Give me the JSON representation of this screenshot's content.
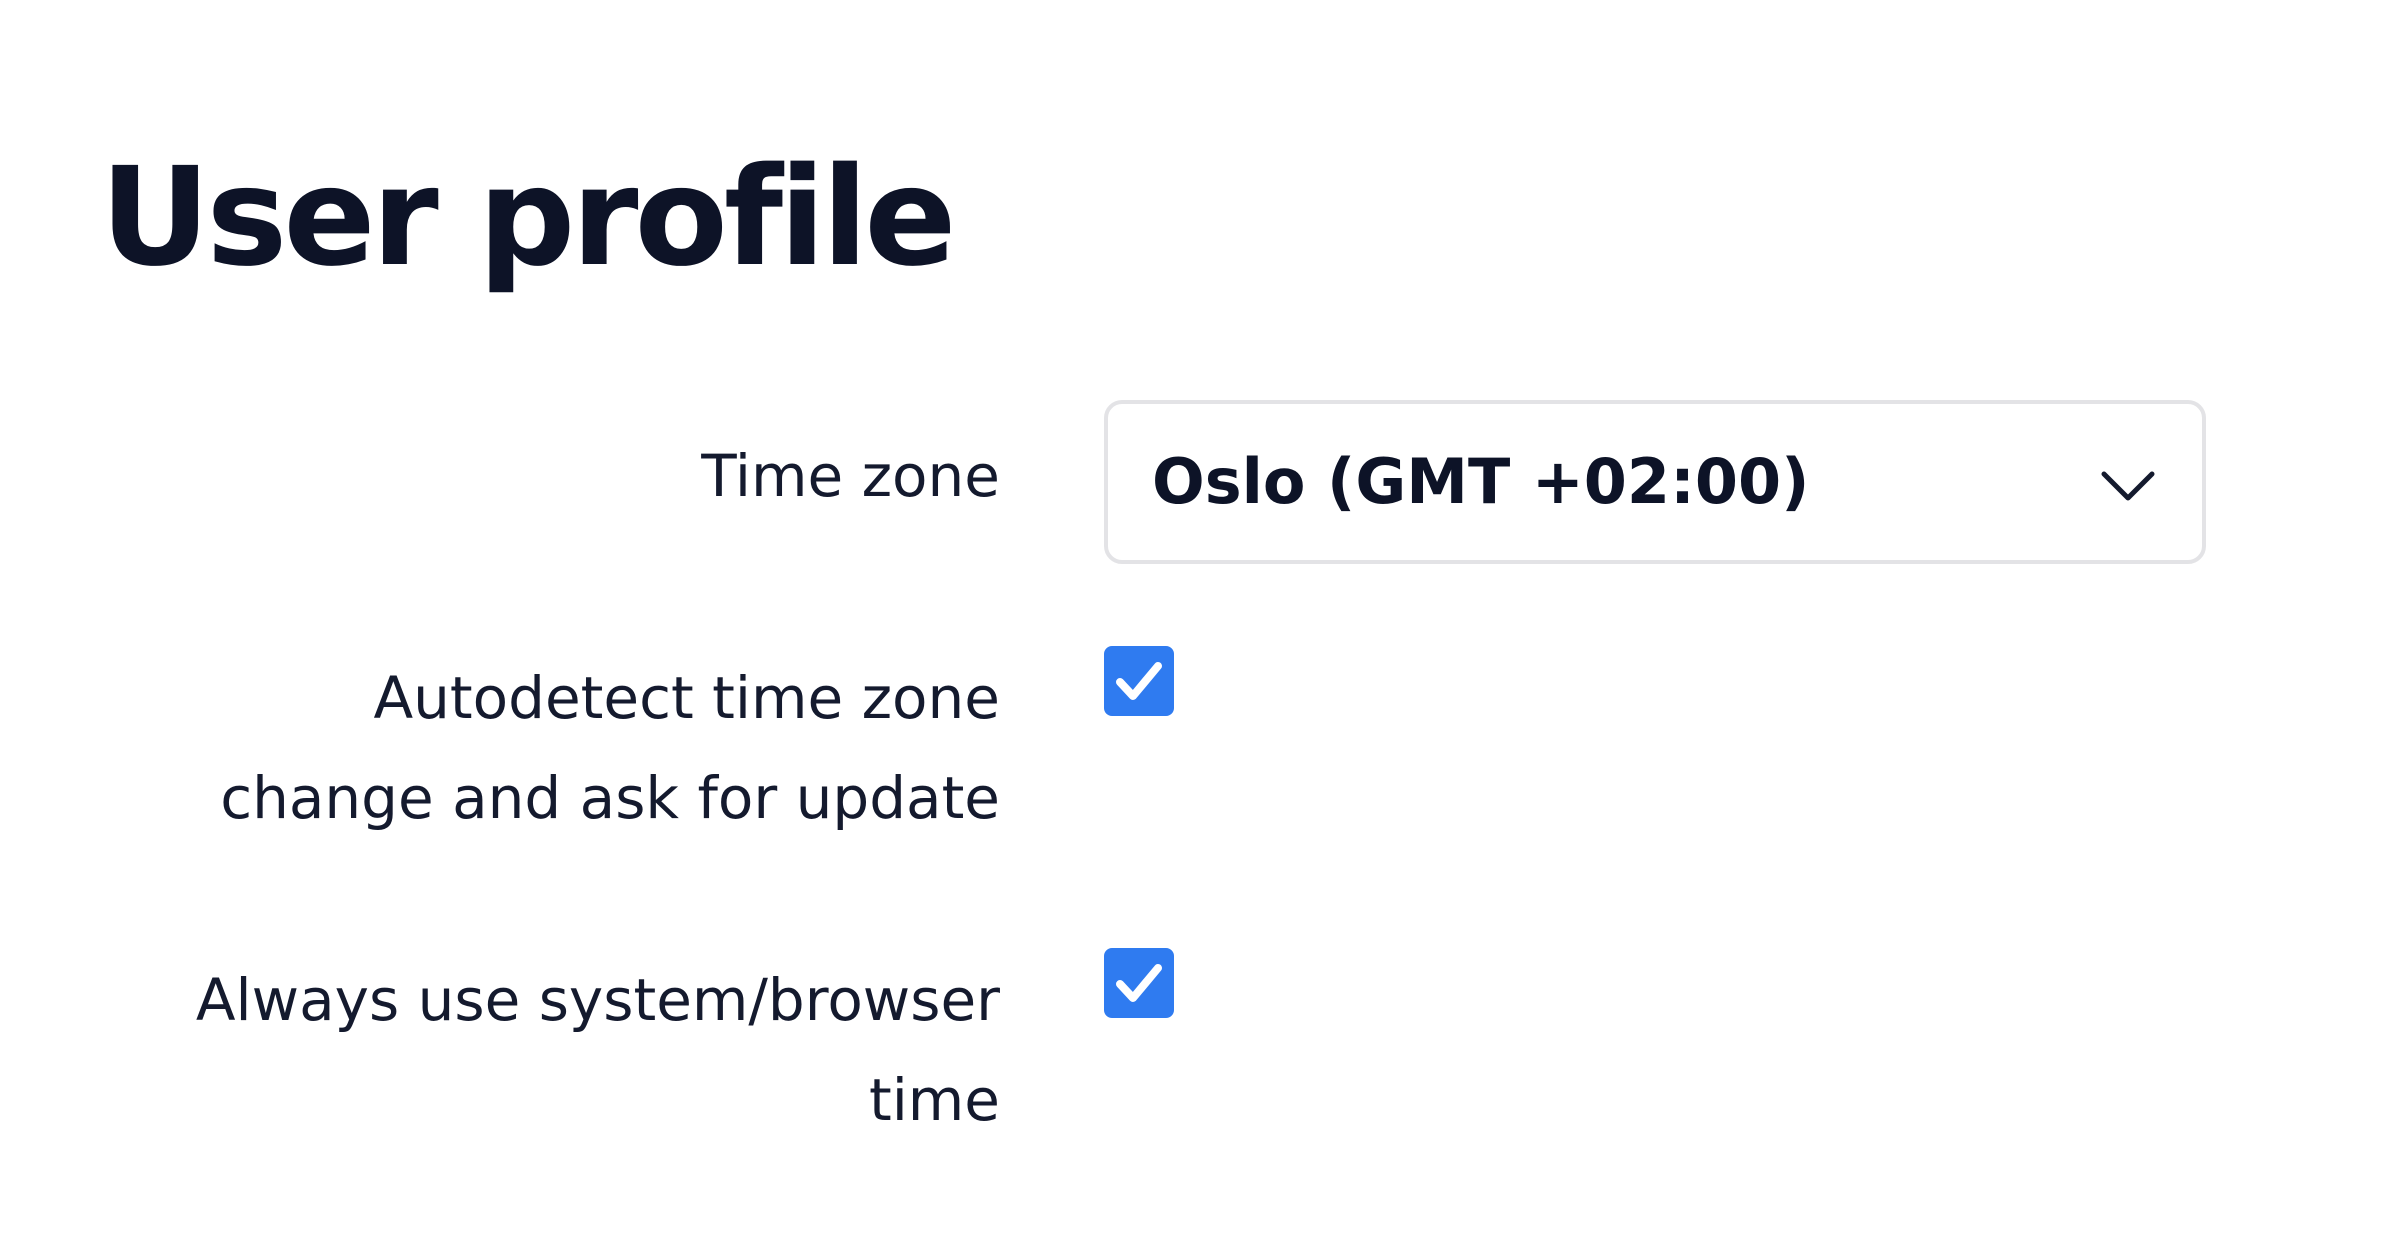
{
  "page": {
    "title": "User profile"
  },
  "fields": {
    "time_zone": {
      "label": "Time zone",
      "selected": "Oslo (GMT +02:00)"
    },
    "autodetect": {
      "label_line1": "Autodetect time zone",
      "label_line2": "change and ask for update",
      "checked": true
    },
    "system_time": {
      "label_line1": "Always use system/browser",
      "label_line2": "time",
      "checked": true
    }
  },
  "colors": {
    "text": "#141a2e",
    "checkbox": "#2f7bf0",
    "select_border": "#e3e3e6"
  },
  "icons": {
    "select": "chevron-down-icon",
    "checkbox": "checkmark-icon"
  }
}
